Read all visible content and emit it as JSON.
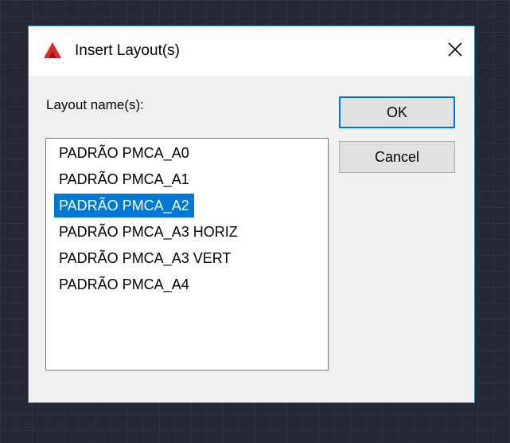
{
  "dialog": {
    "title": "Insert Layout(s)",
    "icon": "autocad-app-icon",
    "close_icon": "close-icon",
    "label": "Layout name(s):",
    "ok_label": "OK",
    "cancel_label": "Cancel"
  },
  "layouts": {
    "items": [
      {
        "label": "PADRÃO PMCA_A0",
        "selected": false
      },
      {
        "label": "PADRÃO PMCA_A1",
        "selected": false
      },
      {
        "label": "PADRÃO PMCA_A2",
        "selected": true
      },
      {
        "label": "PADRÃO PMCA_A3 HORIZ",
        "selected": false
      },
      {
        "label": "PADRÃO PMCA_A3 VERT",
        "selected": false
      },
      {
        "label": "PADRÃO PMCA_A4",
        "selected": false
      }
    ]
  },
  "colors": {
    "selection": "#0078d7",
    "dialog_border": "#2b89b8",
    "background": "#232834",
    "app_icon": "#d42b2b"
  }
}
